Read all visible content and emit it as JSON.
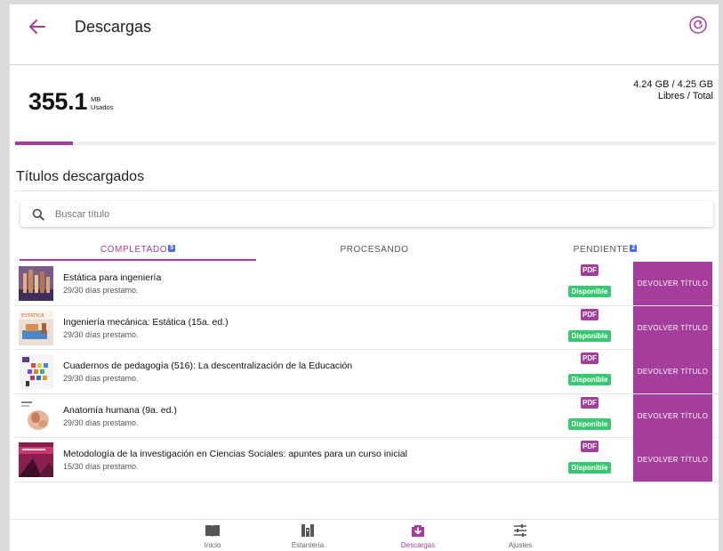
{
  "header": {
    "title": "Descargas",
    "back_icon": "arrow-left-icon",
    "refresh_icon": "refresh-icon"
  },
  "storage": {
    "used_value": "355.1",
    "used_unit": "MB",
    "used_label": "Usados",
    "free_total_value": "4.24 GB / 4.25 GB",
    "free_total_label": "Libres / Total",
    "used_fraction": 0.083
  },
  "section": {
    "title": "Títulos descargados"
  },
  "search": {
    "placeholder": "Buscar título",
    "value": ""
  },
  "tabs": [
    {
      "label": "COMPLETADO",
      "count": "5",
      "active": true
    },
    {
      "label": "PROCESANDO",
      "count": "",
      "active": false
    },
    {
      "label": "PENDIENTE",
      "count": "2",
      "active": false
    }
  ],
  "books": [
    {
      "title": "Estática para ingeniería",
      "days": "29/30 días prestamo.",
      "format": "PDF",
      "status": "Disponible",
      "action": "DEVOLVER TÍTULO",
      "cover": "city-cover"
    },
    {
      "title": "Ingeniería mecánica: Estática (15a. ed.)",
      "days": "29/30 días prestamo.",
      "format": "PDF",
      "status": "Disponible",
      "action": "DEVOLVER TÍTULO",
      "cover": "mechanics-cover",
      "cover_text": "ESTATICA"
    },
    {
      "title": "Cuadernos de pedagogía (516): La descentralización de la Educación",
      "days": "29/30 días prestamo.",
      "format": "PDF",
      "status": "Disponible",
      "action": "DEVOLVER TÍTULO",
      "cover": "pedagogy-cover"
    },
    {
      "title": "Anatomía humana (9a. ed.)",
      "days": "29/30 días prestamo.",
      "format": "PDF",
      "status": "Disponible",
      "action": "DEVOLVER TÍTULO",
      "cover": "anatomy-cover"
    },
    {
      "title": "Metodología de la investigación en Ciencias Sociales: apuntes para un curso inicial",
      "days": "15/30 días prestamo.",
      "format": "PDF",
      "status": "Disponible",
      "action": "DEVOLVER TÍTULO",
      "cover": "methodology-cover"
    }
  ],
  "nav": [
    {
      "label": "Inicio",
      "icon": "book-open-icon",
      "active": false
    },
    {
      "label": "Estantería",
      "icon": "bookshelf-icon",
      "active": false
    },
    {
      "label": "Descargas",
      "icon": "download-icon",
      "active": true
    },
    {
      "label": "Ajustes",
      "icon": "sliders-icon",
      "active": false
    }
  ],
  "colors": {
    "accent": "#a43d9b",
    "available": "#37c871",
    "badge": "#4a6cf0"
  }
}
